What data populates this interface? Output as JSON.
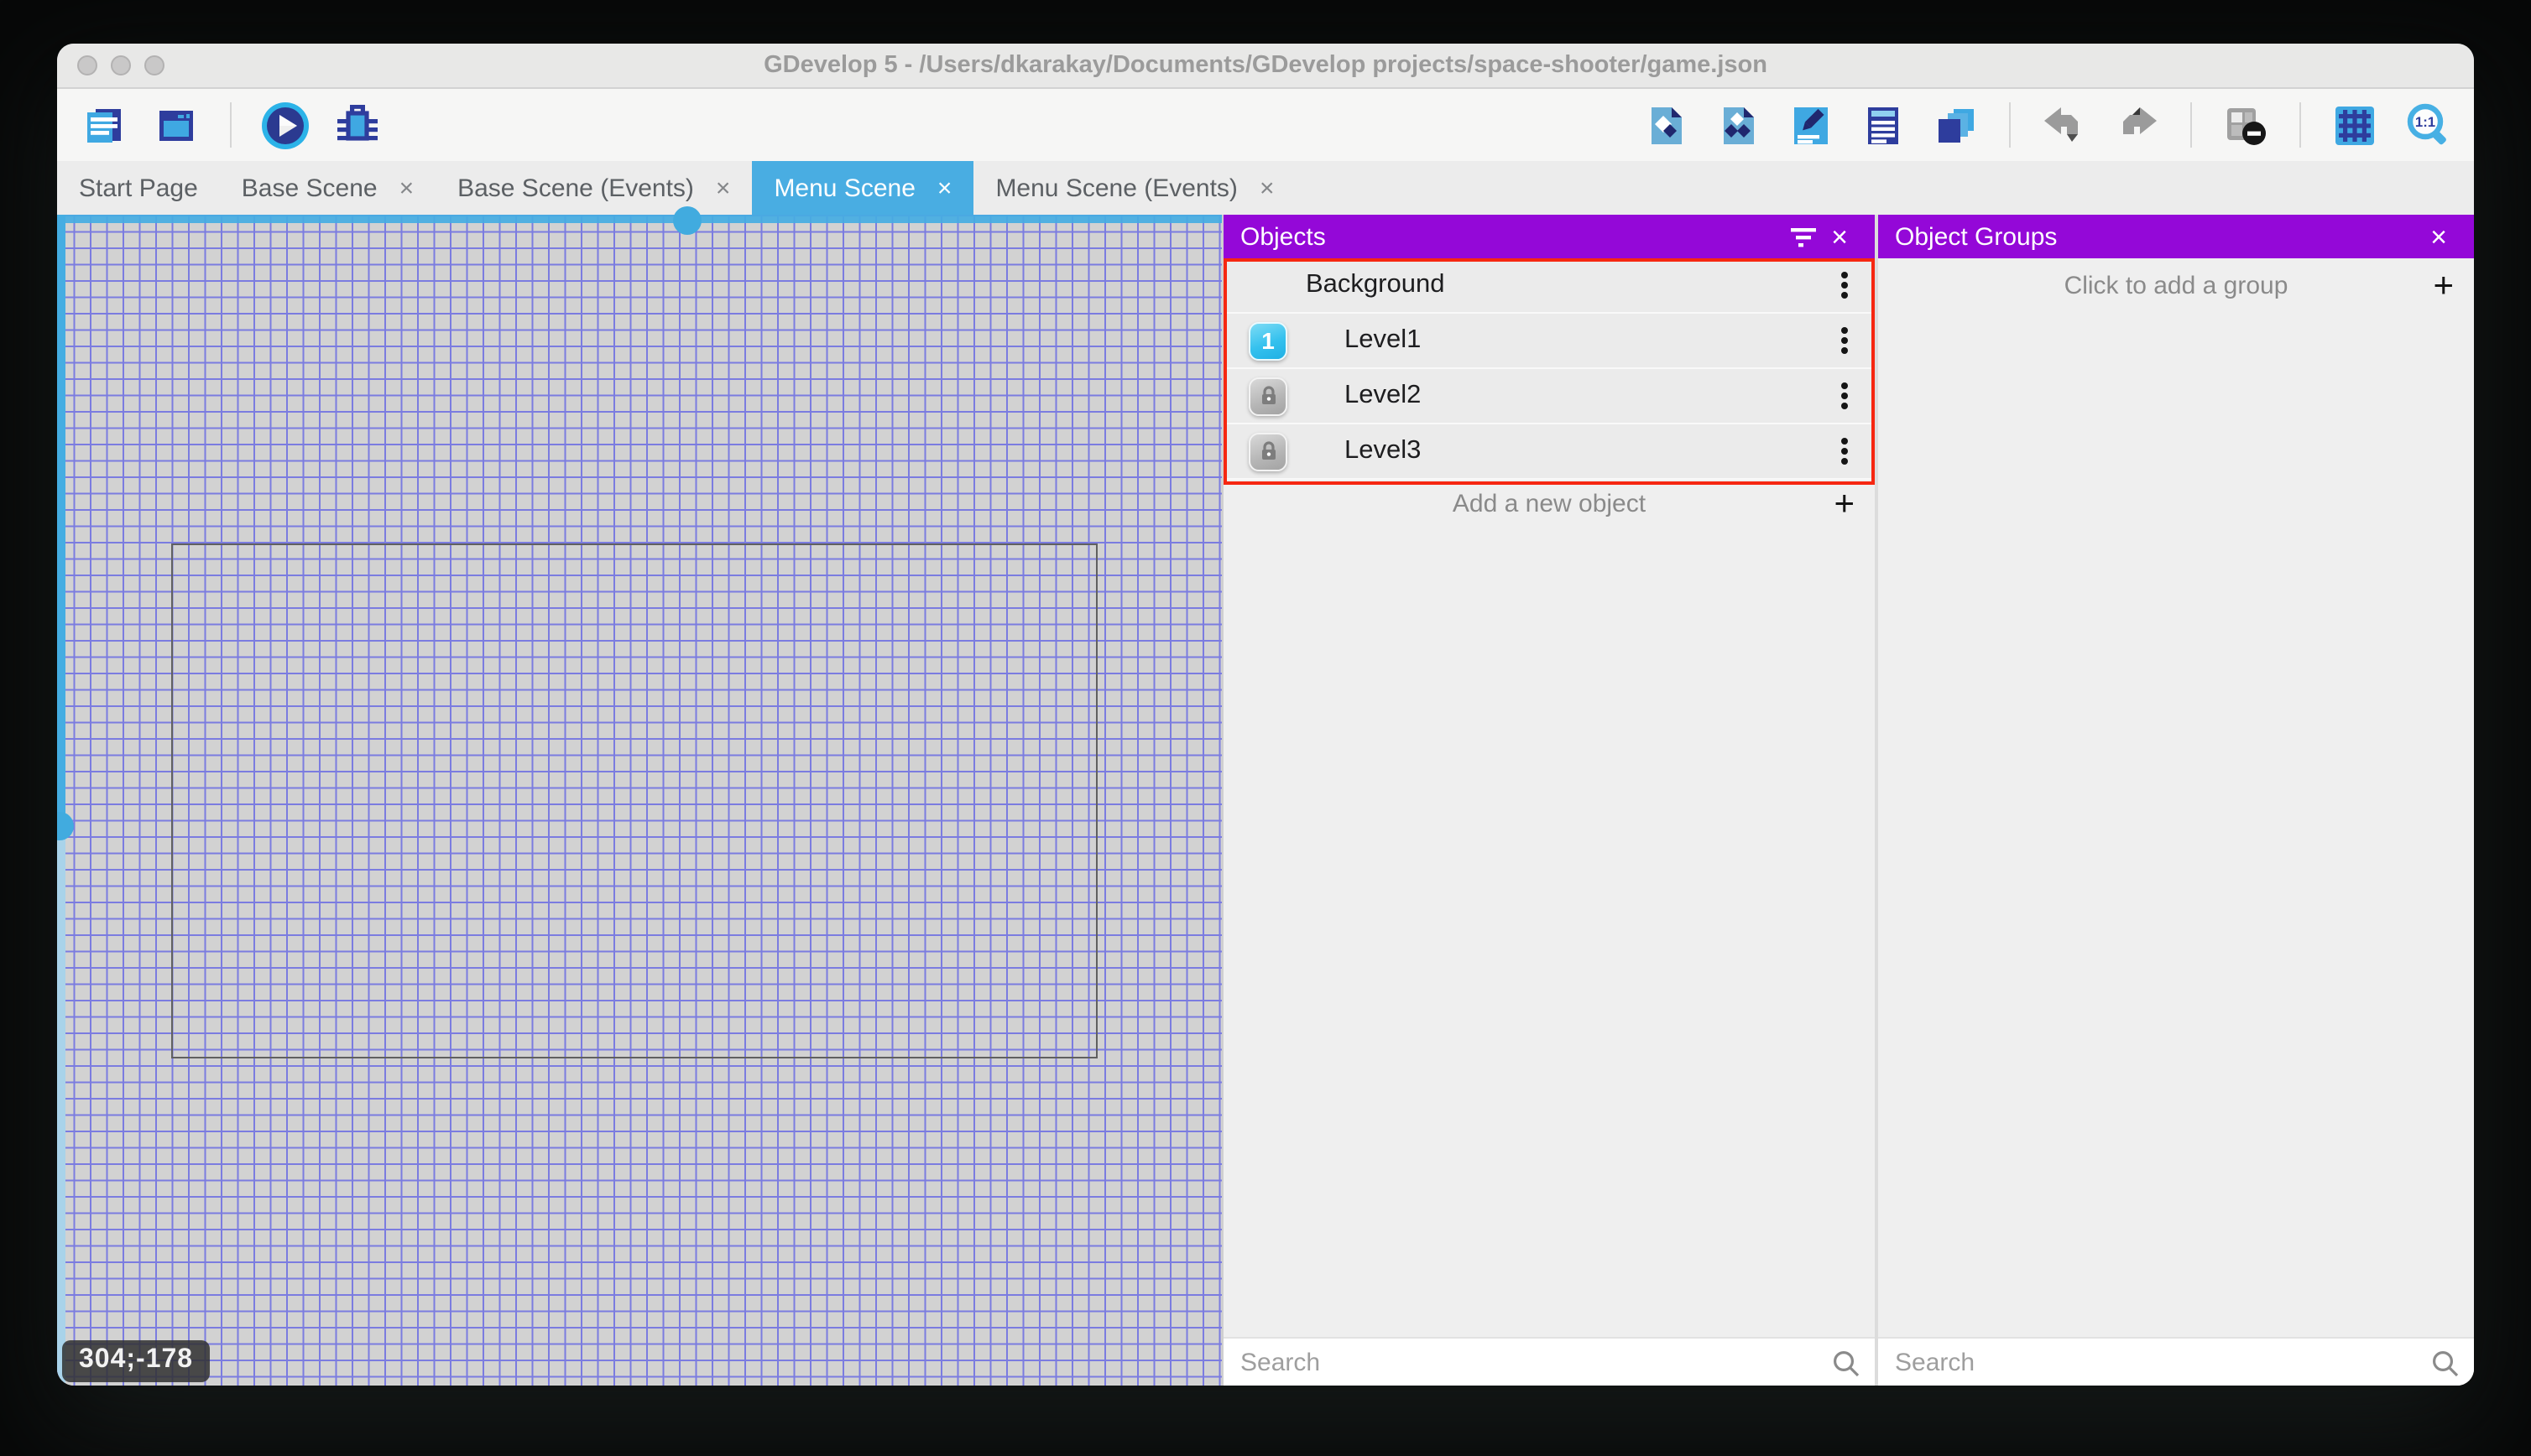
{
  "window": {
    "title": "GDevelop 5 - /Users/dkarakay/Documents/GDevelop projects/space-shooter/game.json"
  },
  "toolbar": {
    "zoom_ratio_label": "1:1"
  },
  "tabs": {
    "close_glyph": "×",
    "items": [
      {
        "label": "Start Page",
        "closable": false,
        "active": false
      },
      {
        "label": "Base Scene",
        "closable": true,
        "active": false
      },
      {
        "label": "Base Scene (Events)",
        "closable": true,
        "active": false
      },
      {
        "label": "Menu Scene",
        "closable": true,
        "active": true
      },
      {
        "label": "Menu Scene (Events)",
        "closable": true,
        "active": false
      }
    ]
  },
  "canvas": {
    "coordinates_label": "304;-178"
  },
  "objects_panel": {
    "title": "Objects",
    "close_glyph": "×",
    "items": [
      {
        "name": "Background"
      },
      {
        "name": "Level1",
        "badge": "1"
      },
      {
        "name": "Level2"
      },
      {
        "name": "Level3"
      }
    ],
    "add_label": "Add a new object",
    "add_glyph": "+",
    "search_placeholder": "Search"
  },
  "groups_panel": {
    "title": "Object Groups",
    "close_glyph": "×",
    "add_label": "Click to add a group",
    "add_glyph": "+",
    "search_placeholder": "Search"
  },
  "colors": {
    "accent_purple": "#9408d8",
    "active_tab_blue": "#49ade2",
    "selection_blue": "#45ade2",
    "annotation_red": "#f62711",
    "grid_line": "#7b7ce0",
    "canvas_bg": "#d2d2d2"
  }
}
